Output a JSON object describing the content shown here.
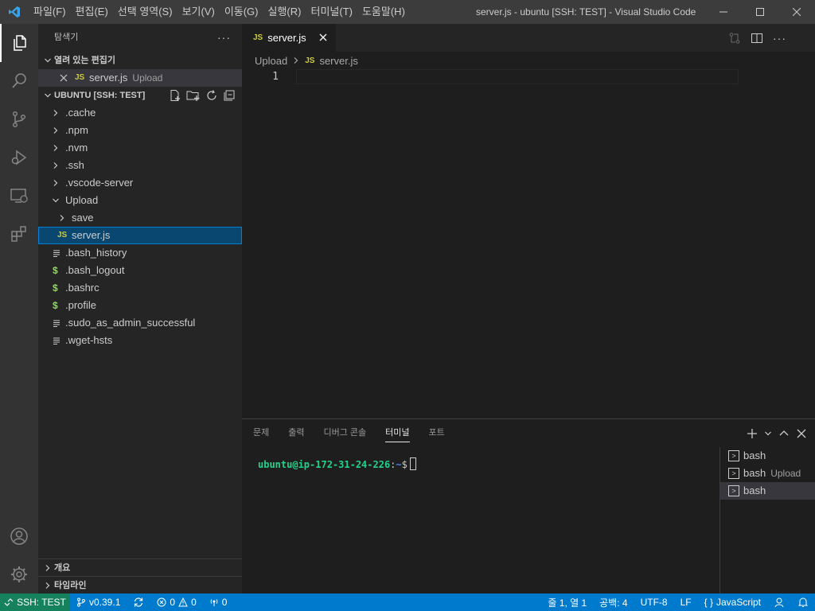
{
  "titlebar": {
    "menu": [
      "파일(F)",
      "편집(E)",
      "선택 영역(S)",
      "보기(V)",
      "이동(G)",
      "실행(R)",
      "터미널(T)",
      "도움말(H)"
    ],
    "title": "server.js - ubuntu [SSH: TEST] - Visual Studio Code"
  },
  "activitybar": {
    "items": [
      "explorer-icon",
      "search-icon",
      "source-control-icon",
      "run-debug-icon",
      "remote-explorer-icon",
      "extensions-icon"
    ],
    "bottom": [
      "account-icon",
      "manage-gear-icon"
    ]
  },
  "sidebar": {
    "title": "탐색기",
    "more": "···",
    "open_editors": {
      "heading": "열려 있는 편집기",
      "items": [
        {
          "badge": "JS",
          "name": "server.js",
          "desc": "Upload"
        }
      ]
    },
    "workspace": {
      "heading": "UBUNTU [SSH: TEST]",
      "items": [
        {
          "name": ".cache",
          "kind": "folder"
        },
        {
          "name": ".npm",
          "kind": "folder"
        },
        {
          "name": ".nvm",
          "kind": "folder"
        },
        {
          "name": ".ssh",
          "kind": "folder"
        },
        {
          "name": ".vscode-server",
          "kind": "folder"
        },
        {
          "name": "Upload",
          "kind": "folder-open"
        },
        {
          "name": "save",
          "kind": "subfolder"
        },
        {
          "name": "server.js",
          "kind": "js",
          "badge": "JS"
        },
        {
          "name": ".bash_history",
          "kind": "text"
        },
        {
          "name": ".bash_logout",
          "kind": "shell",
          "badge": "$"
        },
        {
          "name": ".bashrc",
          "kind": "shell",
          "badge": "$"
        },
        {
          "name": ".profile",
          "kind": "shell",
          "badge": "$"
        },
        {
          "name": ".sudo_as_admin_successful",
          "kind": "text"
        },
        {
          "name": ".wget-hsts",
          "kind": "text"
        }
      ]
    },
    "outline": "개요",
    "timeline": "타임라인"
  },
  "editor": {
    "tab": {
      "badge": "JS",
      "name": "server.js"
    },
    "breadcrumb": {
      "folder": "Upload",
      "badge": "JS",
      "file": "server.js"
    },
    "line_number": "1"
  },
  "panel": {
    "tabs": [
      "문제",
      "출력",
      "디버그 콘솔",
      "터미널",
      "포트"
    ],
    "active_tab": "터미널",
    "prompt": {
      "user": "ubuntu@ip-172-31-24-226",
      "sep": ":",
      "path": "~",
      "end": "$"
    },
    "terminals": [
      {
        "name": "bash",
        "desc": ""
      },
      {
        "name": "bash",
        "desc": "Upload"
      },
      {
        "name": "bash",
        "desc": ""
      }
    ]
  },
  "statusbar": {
    "remote": "SSH: TEST",
    "branch": "v0.39.1",
    "errors": "0",
    "warnings": "0",
    "ports": "0",
    "position": "줄 1, 열 1",
    "spaces": "공백: 4",
    "encoding": "UTF-8",
    "eol": "LF",
    "language": "JavaScript"
  },
  "colors": {
    "accent": "#007acc",
    "remote": "#16825d",
    "js": "#cbcb41",
    "shell": "#89e051"
  }
}
